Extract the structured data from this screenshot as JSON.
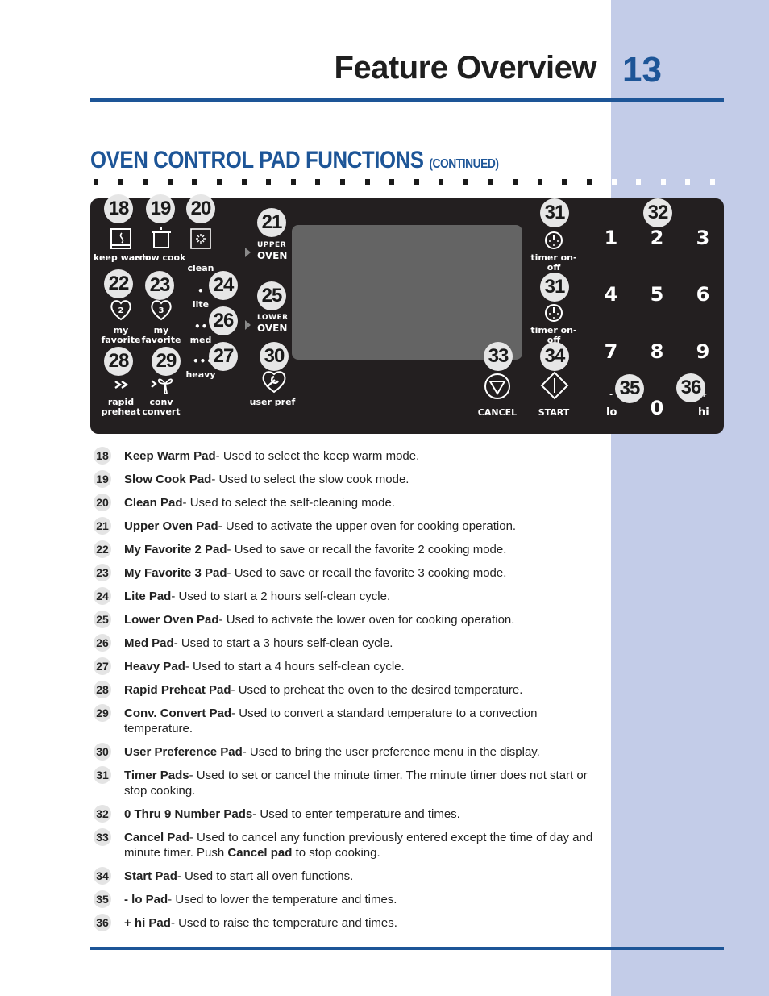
{
  "header": {
    "title": "Feature Overview",
    "page_number": "13"
  },
  "section": {
    "title": "OVEN CONTROL PAD FUNCTIONS",
    "continued": "(CONTINUED)"
  },
  "colors": {
    "brand_blue": "#1d5597",
    "sidebar": "#c3cce8",
    "panel": "#231f20",
    "display": "#646464",
    "badge": "#e6e6e6"
  },
  "panel": {
    "badges": {
      "b18": "18",
      "b19": "19",
      "b20": "20",
      "b21": "21",
      "b22": "22",
      "b23": "23",
      "b24": "24",
      "b25": "25",
      "b26": "26",
      "b27": "27",
      "b28": "28",
      "b29": "29",
      "b30": "30",
      "b31a": "31",
      "b31b": "31",
      "b32": "32",
      "b33": "33",
      "b34": "34",
      "b35": "35",
      "b36": "36"
    },
    "labels": {
      "keep_warm": "keep warm",
      "slow_cook": "slow cook",
      "clean": "clean",
      "upper_small": "UPPER",
      "upper_big": "OVEN",
      "lower_small": "LOWER",
      "lower_big": "OVEN",
      "fav2_num": "2",
      "fav3_num": "3",
      "my_favorite_2": "my favorite",
      "my_favorite_3": "my favorite",
      "lite": "lite",
      "med": "med",
      "heavy": "heavy",
      "lite_dots": "•",
      "med_dots": "••",
      "heavy_dots": "•••",
      "rapid_preheat": "rapid preheat",
      "conv_convert": "conv convert",
      "user_pref": "user pref",
      "timer_1": "timer on-off",
      "timer_2": "timer on-off",
      "cancel": "CANCEL",
      "start": "START",
      "lo": "lo",
      "hi": "hi",
      "minus": "-",
      "plus": "+"
    },
    "keypad": [
      "1",
      "2",
      "3",
      "4",
      "5",
      "6",
      "7",
      "8",
      "9",
      "0"
    ]
  },
  "items": [
    {
      "num": "18",
      "name": "Keep Warm Pad",
      "desc": "- Used to select the keep warm mode."
    },
    {
      "num": "19",
      "name": "Slow Cook Pad",
      "desc": "- Used to select the slow cook mode."
    },
    {
      "num": "20",
      "name": "Clean Pad",
      "desc": "- Used to select the self-cleaning mode."
    },
    {
      "num": "21",
      "name": "Upper Oven Pad",
      "desc": "- Used to activate the upper oven for cooking operation."
    },
    {
      "num": "22",
      "name": "My Favorite 2 Pad",
      "desc": "- Used to save or recall the favorite 2 cooking mode."
    },
    {
      "num": "23",
      "name": "My Favorite 3 Pad",
      "desc": "- Used to save or recall the favorite 3 cooking mode."
    },
    {
      "num": "24",
      "name": "Lite Pad",
      "desc": "- Used to start a 2 hours self-clean cycle."
    },
    {
      "num": "25",
      "name": "Lower Oven Pad",
      "desc": "- Used to activate the lower oven for cooking operation."
    },
    {
      "num": "26",
      "name": "Med Pad",
      "desc": "- Used to start a 3 hours self-clean cycle."
    },
    {
      "num": "27",
      "name": "Heavy Pad",
      "desc": "- Used to start a 4 hours self-clean cycle."
    },
    {
      "num": "28",
      "name": "Rapid Preheat Pad",
      "desc": "- Used to preheat the oven to the desired temperature."
    },
    {
      "num": "29",
      "name": "Conv. Convert Pad",
      "desc": "- Used to convert a standard temperature to a convection temperature."
    },
    {
      "num": "30",
      "name": "User Preference Pad",
      "desc": "- Used to bring the user preference menu in the display."
    },
    {
      "num": "31",
      "name": "Timer Pads",
      "desc": "- Used to set or cancel the minute timer. The minute timer does not start or stop cooking."
    },
    {
      "num": "32",
      "name": "0 Thru 9 Number Pads",
      "desc": "- Used to enter temperature and times."
    },
    {
      "num": "33",
      "name": "Cancel Pad",
      "desc": "- Used to cancel any function previously entered except the time of day and minute timer. Push ",
      "bold2": "Cancel pad",
      "desc2": " to stop cooking."
    },
    {
      "num": "34",
      "name": "Start Pad",
      "desc": "- Used to start all oven functions."
    },
    {
      "num": "35",
      "name": "- lo Pad",
      "desc": "- Used to lower the temperature and times."
    },
    {
      "num": "36",
      "name": "+ hi Pad",
      "desc": "- Used to raise the temperature and times."
    }
  ]
}
